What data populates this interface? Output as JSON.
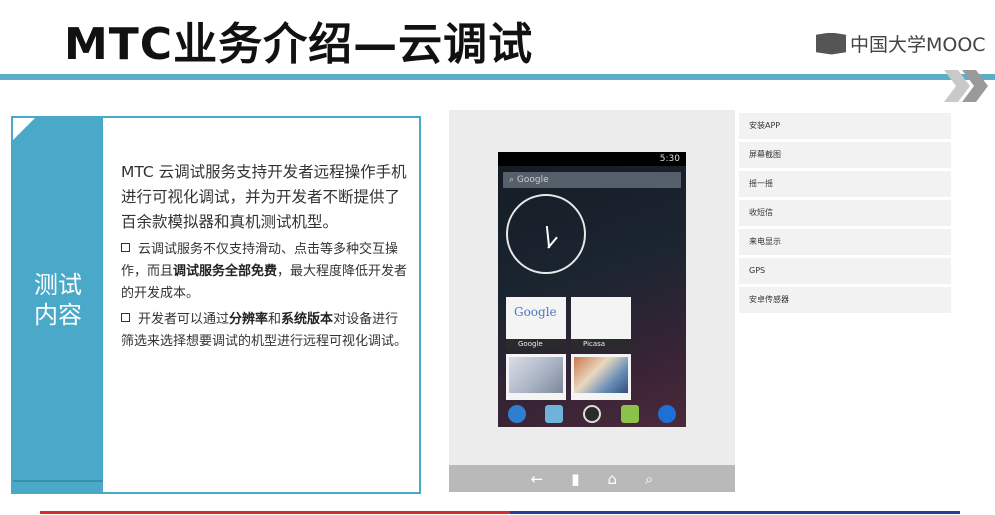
{
  "slide": {
    "title": "MTC业务介绍—云调试",
    "logo_text": "中国大学MOOC"
  },
  "card": {
    "side_label_line1": "测试",
    "side_label_line2": "内容",
    "intro": "MTC 云调试服务支持开发者远程操作手机进行可视化调试，并为开发者不断提供了百余款模拟器和真机测试机型。",
    "bullet1_a": "云调试服务不仅支持滑动、点击等多种交互操作，而且",
    "bullet1_bold": "调试服务全部免费",
    "bullet1_b": "，最大程度降低开发者的开发成本。",
    "bullet2_a": "开发者可以通过",
    "bullet2_bold1": "分辨率",
    "bullet2_and": "和",
    "bullet2_bold2": "系统版本",
    "bullet2_b": "对设备进行筛选来选择想要调试的机型进行远程可视化调试。"
  },
  "phone": {
    "time": "5:30",
    "search_placeholder": "Google",
    "tile1_caption": "Google",
    "tile1_brand": "Google",
    "tile2_caption": "Picasa"
  },
  "nav": {
    "back_icon": "back-arrow-icon",
    "menu_icon": "menu-icon",
    "home_icon": "home-icon",
    "search_icon": "search-icon"
  },
  "features": [
    "安装APP",
    "屏幕截图",
    "摇一摇",
    "收短信",
    "来电显示",
    "GPS",
    "安卓传感器"
  ],
  "colors": {
    "accent": "#4aa9c9",
    "rule": "#5aaec8",
    "bottom_red": "#d92a2a",
    "bottom_blue": "#2b3d9a"
  }
}
